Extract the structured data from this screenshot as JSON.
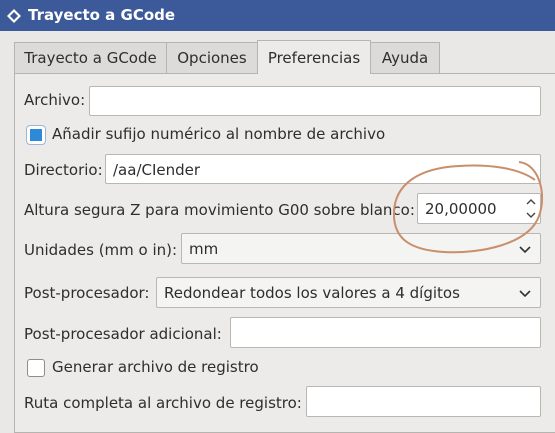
{
  "window": {
    "title": "Trayecto a GCode"
  },
  "tabs": [
    {
      "label": "Trayecto a GCode",
      "active": false
    },
    {
      "label": "Opciones",
      "active": false
    },
    {
      "label": "Preferencias",
      "active": true
    },
    {
      "label": "Ayuda",
      "active": false
    }
  ],
  "form": {
    "archivo": {
      "label": "Archivo:",
      "value": ""
    },
    "sufijo": {
      "label": "Añadir sufijo numérico al nombre de archivo",
      "checked": true
    },
    "directorio": {
      "label": "Directorio:",
      "value": "/aa/CIender"
    },
    "altura": {
      "label": "Altura segura Z para movimiento G00 sobre blanco:",
      "value": "20,00000"
    },
    "unidades": {
      "label": "Unidades (mm o in):",
      "value": "mm"
    },
    "post": {
      "label": "Post-procesador:",
      "value": "Redondear todos los valores a 4 dígitos"
    },
    "post_adicional": {
      "label": "Post-procesador adicional:",
      "value": ""
    },
    "registro": {
      "label": "Generar archivo de registro",
      "checked": false
    },
    "ruta_registro": {
      "label": "Ruta completa al archivo de registro:",
      "value": ""
    }
  },
  "colors": {
    "titlebar": "#3c5a99",
    "accent": "#2d8ad8",
    "annotation": "#c98f6a"
  },
  "icons": [
    "app-icon",
    "chevron-down-icon",
    "spin-up-icon",
    "spin-down-icon",
    "checkbox-checked-icon"
  ]
}
